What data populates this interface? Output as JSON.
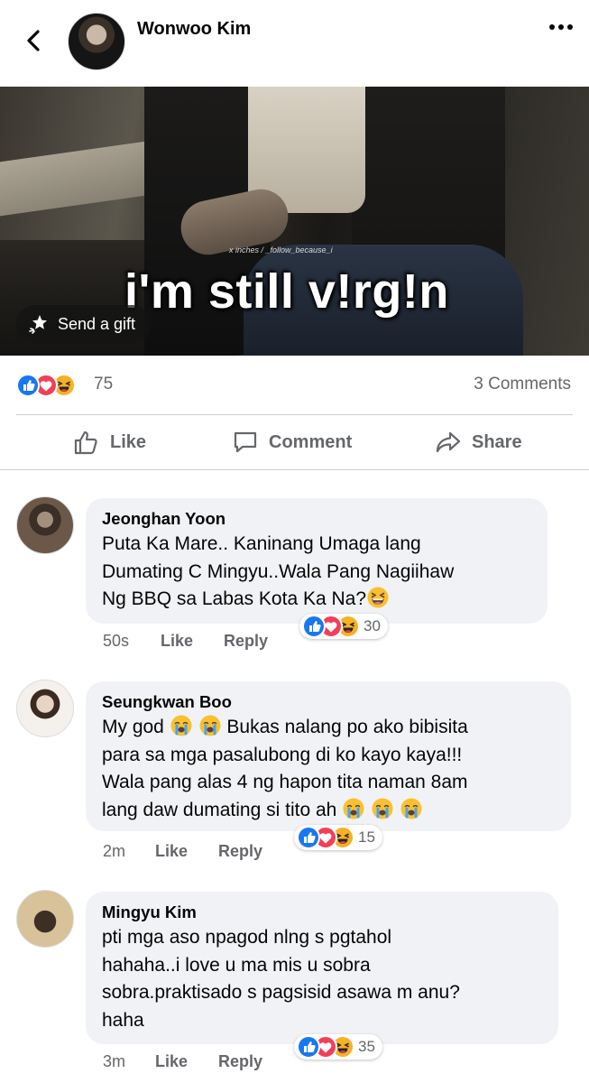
{
  "header": {
    "name": "Wonwoo Kim",
    "back_icon": "chevron-left-icon",
    "more_icon": "more-dots-icon"
  },
  "post": {
    "image_caption": "i'm still v!rg!n",
    "watermark": "x inches / _follow_because_i",
    "send_gift_label": "Send a gift",
    "reaction_count": "75",
    "comments_count": "3 Comments"
  },
  "actions": {
    "like": "Like",
    "comment": "Comment",
    "share": "Share"
  },
  "comments": [
    {
      "name": "Jeonghan Yoon",
      "lines": [
        "Puta Ka Mare.. Kaninang Umaga lang",
        "Dumating C Mingyu..Wala Pang Nagiihaw",
        "Ng BBQ sa Labas Kota Ka Na?"
      ],
      "trailing_emoji": [
        "laughing"
      ],
      "time": "50s",
      "like": "Like",
      "reply": "Reply",
      "reactions": "30"
    },
    {
      "name": "Seungkwan Boo",
      "lines": [
        "My god",
        "Bukas nalang po ako bibisita",
        "para sa mga pasalubong di ko kayo kaya!!!",
        "Wala pang alas 4 ng hapon tita naman 8am",
        "lang daw dumating si tito ah"
      ],
      "time": "2m",
      "like": "Like",
      "reply": "Reply",
      "reactions": "15"
    },
    {
      "name": "Mingyu Kim",
      "lines": [
        "pti mga aso npagod nlng s pgtahol",
        "hahaha..i love u ma mis u sobra",
        "sobra.praktisado s pagsisid asawa m anu?",
        "haha"
      ],
      "time": "3m",
      "like": "Like",
      "reply": "Reply",
      "reactions": "35"
    }
  ],
  "colors": {
    "like_blue": "#1877f2",
    "love_red": "#f33e58",
    "haha_yellow": "#f7b125",
    "muted": "#65676b",
    "bubble": "#f0f2f5"
  }
}
